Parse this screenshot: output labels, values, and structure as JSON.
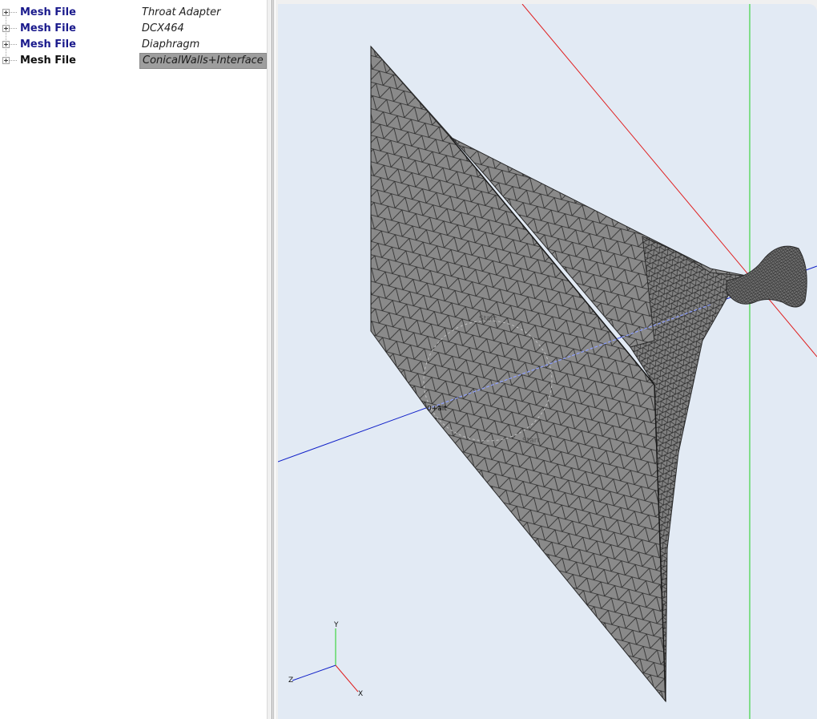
{
  "tree": {
    "items": [
      {
        "type": "Mesh File",
        "name": "Throat Adapter"
      },
      {
        "type": "Mesh File",
        "name": "DCX464"
      },
      {
        "type": "Mesh File",
        "name": "Diaphragm"
      },
      {
        "type": "Mesh File",
        "name": "ConicalWalls+Interface"
      }
    ]
  },
  "viewport": {
    "mesh_labels": {
      "start_top": "Start",
      "start_bottom": "Start",
      "origin": "0+ait"
    },
    "triad": {
      "y": "Y",
      "z": "Z",
      "x": "X"
    },
    "colors": {
      "background": "#e2eaf4",
      "mesh_fill": "#8a8a8a",
      "mesh_edge": "#2a2a2a",
      "x_axis": "#e02020",
      "y_axis": "#20d020",
      "z_axis": "#1020c8"
    }
  }
}
